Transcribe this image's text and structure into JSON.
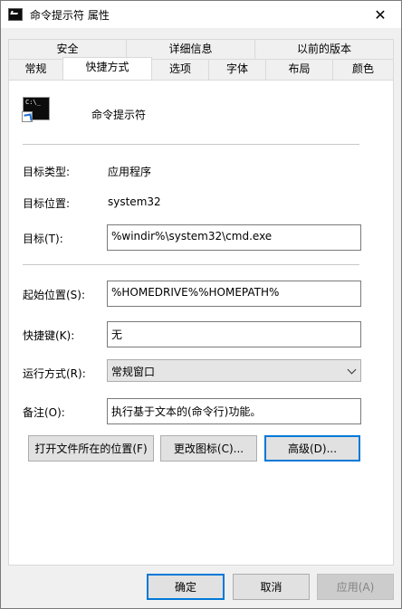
{
  "window": {
    "title": "命令提示符 属性",
    "close_glyph": "✕"
  },
  "tabs": {
    "back_row": [
      "安全",
      "详细信息",
      "以前的版本"
    ],
    "front_row": [
      "常规",
      "快捷方式",
      "选项",
      "字体",
      "布局",
      "颜色"
    ],
    "active": "快捷方式"
  },
  "shortcut": {
    "app_name": "命令提示符",
    "icon_text": "C:\\_",
    "target_type_label": "目标类型:",
    "target_type_value": "应用程序",
    "target_location_label": "目标位置:",
    "target_location_value": "system32",
    "target_label": "目标(T):",
    "target_value": "%windir%\\system32\\cmd.exe",
    "start_in_label": "起始位置(S):",
    "start_in_value": "%HOMEDRIVE%%HOMEPATH%",
    "hotkey_label": "快捷键(K):",
    "hotkey_value": "无",
    "run_label": "运行方式(R):",
    "run_value": "常规窗口",
    "comment_label": "备注(O):",
    "comment_value": "执行基于文本的(命令行)功能。"
  },
  "buttons": {
    "open_location": "打开文件所在的位置(F)",
    "change_icon": "更改图标(C)...",
    "advanced": "高级(D)...",
    "ok": "确定",
    "cancel": "取消",
    "apply": "应用(A)"
  },
  "colors": {
    "accent": "#0078d7",
    "panel_bg": "#ffffff",
    "dialog_bg": "#f0f0f0"
  }
}
